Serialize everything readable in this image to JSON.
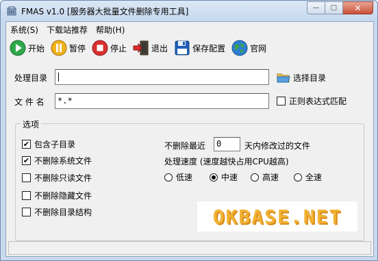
{
  "window": {
    "title": "FMAS v1.0 [服务器大批量文件删除专用工具]",
    "buttons": {
      "minimize": "—",
      "maximize": "□",
      "close": "✕"
    }
  },
  "menu": [
    {
      "label": "系统(S)"
    },
    {
      "label": "下载站推荐"
    },
    {
      "label": "帮助(H)"
    }
  ],
  "toolbar": {
    "start": "开始",
    "pause": "暂停",
    "stop": "停止",
    "exit": "退出",
    "save": "保存配置",
    "website": "官网"
  },
  "form": {
    "dir_label": "处理目录",
    "dir_value": "",
    "choose_dir": "选择目录",
    "filename_label": "文 件 名",
    "filename_value": "*.*",
    "regex_label": "正则表达式匹配",
    "regex_checked": false
  },
  "options": {
    "title": "选项",
    "checkboxes": [
      {
        "label": "包含子目录",
        "checked": true
      },
      {
        "label": "不删除系统文件",
        "checked": true
      },
      {
        "label": "不删除只读文件",
        "checked": false
      },
      {
        "label": "不删除隐藏文件",
        "checked": false
      },
      {
        "label": "不删除目录结构",
        "checked": false
      }
    ],
    "recent_prefix": "不删除最近",
    "recent_days": "0",
    "recent_suffix": "天内修改过的文件",
    "speed_label": "处理速度 (速度越快占用CPU越高)",
    "speeds": [
      {
        "label": "低速",
        "selected": false
      },
      {
        "label": "中速",
        "selected": true
      },
      {
        "label": "高速",
        "selected": false
      },
      {
        "label": "全速",
        "selected": false
      }
    ]
  },
  "banner": {
    "text": "OKBASE.NET"
  },
  "status": {
    "text": ""
  },
  "colors": {
    "banner_text": "#f2b233",
    "frame": "#c9daee"
  }
}
